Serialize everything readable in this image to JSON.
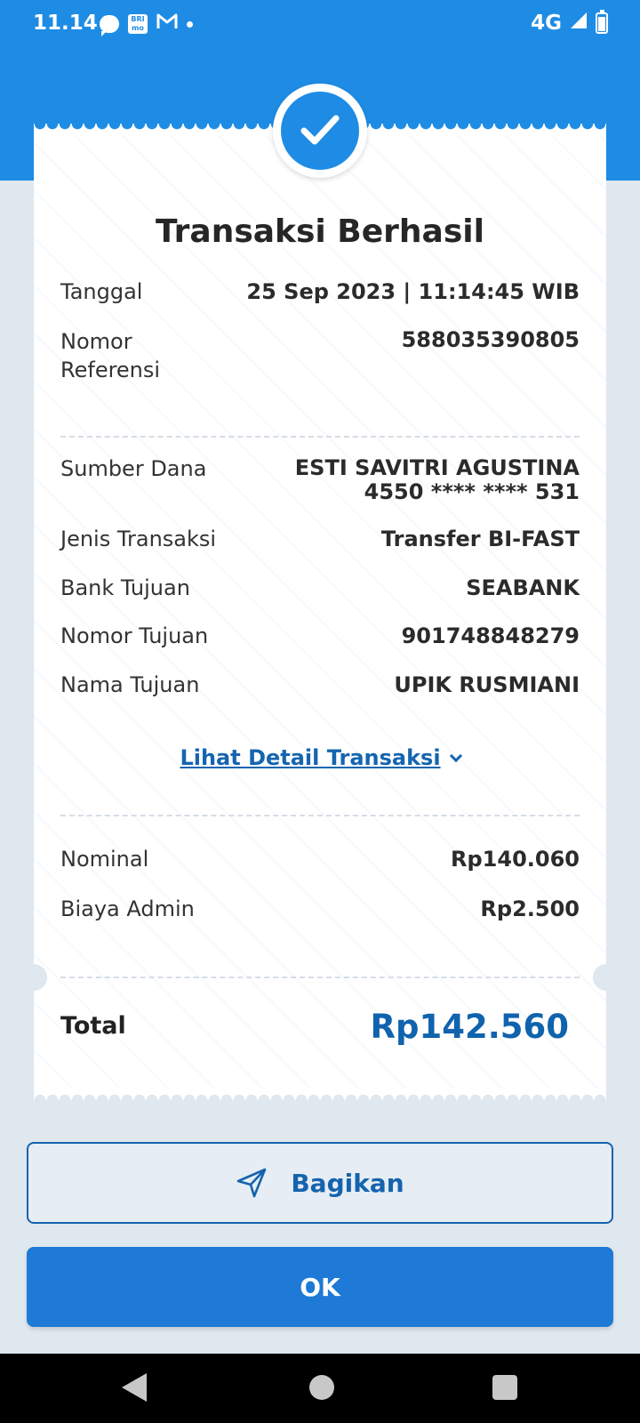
{
  "status_bar": {
    "time": "11.14",
    "network": "4G",
    "icons": [
      "chat-bubble-icon",
      "brimo-icon",
      "gmail-icon",
      "dot-icon",
      "signal-icon",
      "battery-icon"
    ]
  },
  "receipt": {
    "title": "Transaksi Berhasil",
    "date_label": "Tanggal",
    "date_value": "25 Sep 2023 | 11:14:45 WIB",
    "ref_label_1": "Nomor",
    "ref_label_2": "Referensi",
    "ref_value": "588035390805",
    "source_label": "Sumber Dana",
    "source_name": "ESTI SAVITRI AGUSTINA",
    "source_account": "4550 **** **** 531",
    "type_label": "Jenis Transaksi",
    "type_value": "Transfer BI-FAST",
    "bank_label": "Bank Tujuan",
    "bank_value": "SEABANK",
    "dest_no_label": "Nomor Tujuan",
    "dest_no_value": "901748848279",
    "dest_name_label": "Nama Tujuan",
    "dest_name_value": "UPIK RUSMIANI",
    "detail_link": "Lihat Detail Transaksi",
    "nominal_label": "Nominal",
    "nominal_value": "Rp140.060",
    "fee_label": "Biaya Admin",
    "fee_value": "Rp2.500",
    "total_label": "Total",
    "total_value": "Rp142.560"
  },
  "actions": {
    "share_label": "Bagikan",
    "ok_label": "OK"
  },
  "colors": {
    "primary": "#1e8ce4",
    "accent_dark": "#1063ad",
    "background": "#dfe7ef"
  }
}
